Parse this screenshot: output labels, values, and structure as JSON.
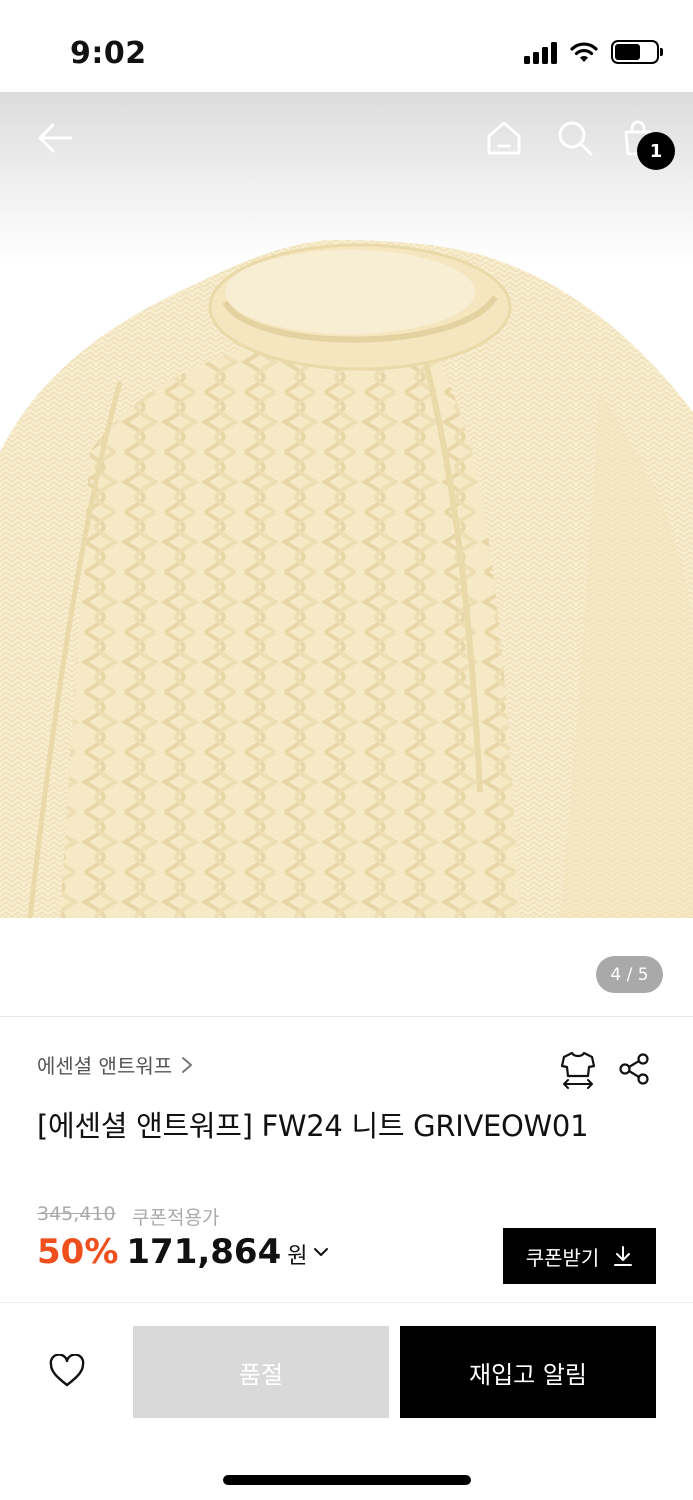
{
  "status_bar": {
    "time": "9:02"
  },
  "gallery": {
    "current": 4,
    "total": 5,
    "indicator": "4 / 5"
  },
  "header": {
    "cart_count": "1"
  },
  "product": {
    "brand": "에센셜 앤트워프",
    "title": "[에센셜 앤트워프] FW24 니트 GRIVEOW01",
    "original_price": "345,410",
    "coupon_note": "쿠폰적용가",
    "discount": "50%",
    "sale_price": "171,864",
    "currency": "원"
  },
  "actions": {
    "coupon_label": "쿠폰받기",
    "soldout_label": "품절",
    "restock_label": "재입고 알림"
  },
  "colors": {
    "discount": "#ef4f1d",
    "primary_button": "#000000",
    "disabled_button": "#d9d9d9",
    "sweater": "#f8edcf"
  },
  "icons": [
    "back-arrow-icon",
    "home-icon",
    "search-icon",
    "shopping-bag-icon",
    "brand-chevron-icon",
    "size-guide-icon",
    "share-icon",
    "price-detail-chevron-icon",
    "download-icon",
    "heart-icon"
  ]
}
